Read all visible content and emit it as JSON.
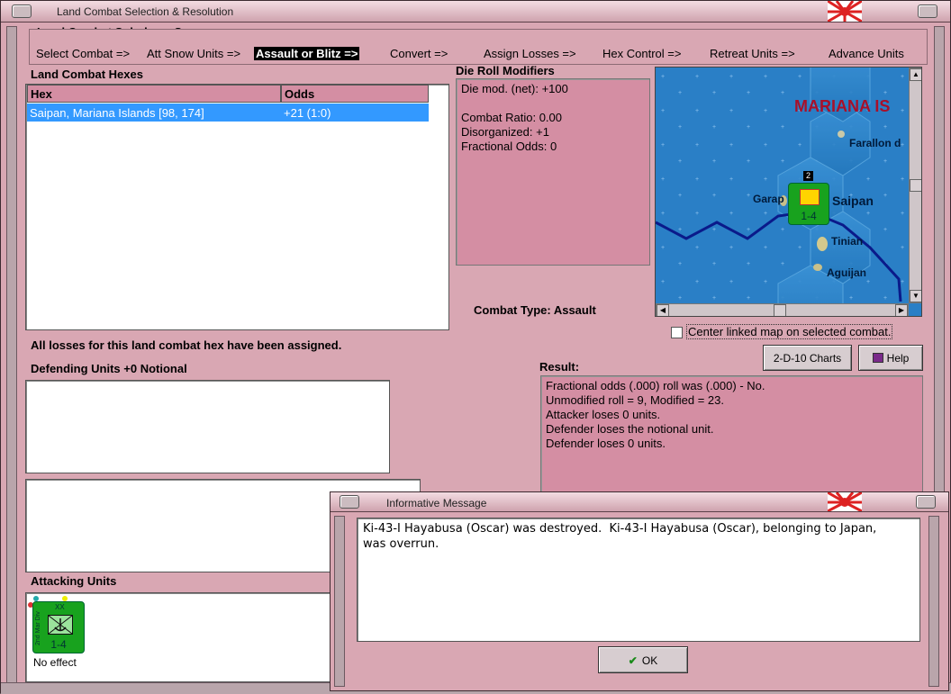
{
  "main_window": {
    "title": "Land Combat Selection & Resolution",
    "subphase_heading": "Land Combat Subphase Sequence",
    "steps": [
      "Select Combat =>",
      "Att Snow Units =>",
      "Assault or Blitz =>",
      "Convert =>",
      "Assign Losses =>",
      "Hex Control =>",
      "Retreat Units =>",
      "Advance Units"
    ],
    "current_step": "Assault or Blitz =>"
  },
  "hexes": {
    "heading": "Land Combat Hexes",
    "columns": [
      "Hex",
      "Odds"
    ],
    "rows": [
      {
        "hex": "Saipan, Mariana Islands [98, 174]",
        "odds": "+21 (1:0)"
      }
    ]
  },
  "modifiers": {
    "heading": "Die Roll Modifiers",
    "net": "Die mod. (net): +100",
    "ratio": "Combat Ratio: 0.00",
    "disorganized": "Disorganized: +1",
    "fractional": "Fractional Odds: 0"
  },
  "combat_type": "Combat Type:  Assault",
  "map": {
    "region_label": "MARIANA IS",
    "places": [
      "Farallon d",
      "Garap",
      "Saipan",
      "Tinian",
      "Aguijan"
    ],
    "stack_count": "2",
    "unit_strength": "1-4",
    "center_label": "Center linked map on selected combat.",
    "center_checked": false
  },
  "status_text": "All losses for this land combat hex have been assigned.",
  "defending_heading": "Defending Units +0 Notional",
  "buttons": {
    "charts": "2-D-10 Charts",
    "help": "Help",
    "ok": "OK"
  },
  "result": {
    "heading": "Result:",
    "lines": [
      "Fractional odds (.000) roll was (.000)  - No.",
      "Unmodified roll = 9, Modified = 23.",
      "Attacker loses 0 units.",
      "Defender loses the notional unit.",
      "Defender loses 0 units."
    ]
  },
  "attacking": {
    "heading": "Attacking Units",
    "unit_strength": "1-4",
    "unit_size": "XX",
    "unit_side_text": "2nd Mar Div",
    "unit_status": "No effect"
  },
  "message_window": {
    "title": "Informative Message",
    "text": "Ki-43-I Hayabusa (Oscar) was destroyed.  Ki-43-I Hayabusa (Oscar), belonging to Japan,\nwas overrun."
  },
  "colors": {
    "pink": "#d9a7b3",
    "panel_pink": "#d48ea3",
    "sea": "#2a7fc6",
    "selection": "#3399ff",
    "unit_green": "#18a21e"
  }
}
